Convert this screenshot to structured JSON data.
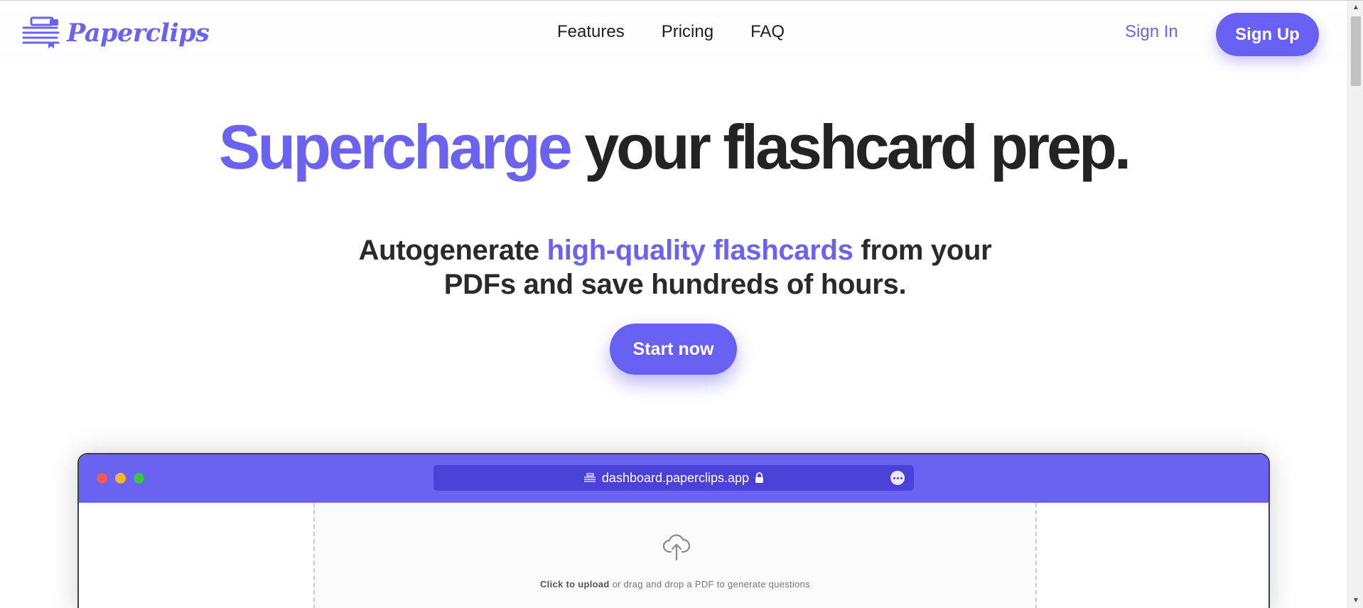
{
  "header": {
    "brand": "Paperclips",
    "nav": [
      "Features",
      "Pricing",
      "FAQ"
    ],
    "sign_in": "Sign In",
    "sign_up": "Sign Up"
  },
  "hero": {
    "title_accent": "Supercharge",
    "title_rest": "your flashcard prep.",
    "subtitle_pre": "Autogenerate",
    "subtitle_accent": "high-quality flashcards",
    "subtitle_post": "from your PDFs and save hundreds of hours.",
    "cta": "Start now"
  },
  "browser": {
    "url": "dashboard.paperclips.app",
    "upload_bold": "Click to upload",
    "upload_rest": "or drag and drop a PDF to generate questions"
  },
  "colors": {
    "accent": "#6b63f0",
    "button": "#6760f2",
    "browser_bar": "#6a62f0",
    "url_bar": "#4a42d6"
  },
  "icons": [
    "stacked-papers-logo-icon",
    "lock-icon",
    "more-options-icon",
    "cloud-upload-icon",
    "scroll-up-arrow-icon",
    "scroll-down-arrow-icon"
  ]
}
